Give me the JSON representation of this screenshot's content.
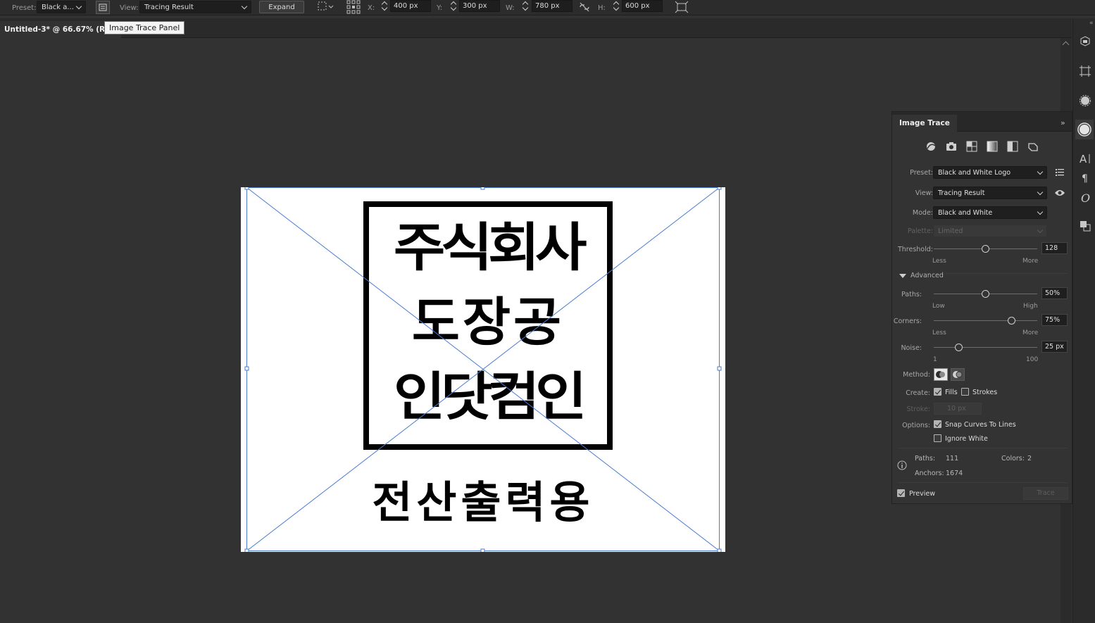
{
  "control_bar": {
    "preset_label": "Preset:",
    "preset_value": "Black a...",
    "view_label": "View:",
    "view_value": "Tracing Result",
    "expand_label": "Expand",
    "x_label": "X:",
    "x_value": "400 px",
    "y_label": "Y:",
    "y_value": "300 px",
    "w_label": "W:",
    "w_value": "780 px",
    "h_label": "H:",
    "h_value": "600 px"
  },
  "document": {
    "tab_title": "Untitled-3* @ 66.67% (RGB",
    "tooltip": "Image Trace Panel"
  },
  "artwork": {
    "seal_rows": [
      "주식회사",
      "도장공",
      "인닷컴인"
    ],
    "caption": "전산출력용"
  },
  "image_trace": {
    "title": "Image Trace",
    "collapse_glyph": "»",
    "preset_label": "Preset:",
    "preset_value": "Black and White Logo",
    "view_label": "View:",
    "view_value": "Tracing Result",
    "mode_label": "Mode:",
    "mode_value": "Black and White",
    "palette_label": "Palette:",
    "palette_value": "Limited",
    "threshold_label": "Threshold:",
    "threshold_value": "128",
    "threshold_min": "Less",
    "threshold_max": "More",
    "advanced_label": "Advanced",
    "paths_label": "Paths:",
    "paths_value": "50%",
    "paths_min": "Low",
    "paths_max": "High",
    "corners_label": "Corners:",
    "corners_value": "75%",
    "corners_min": "Less",
    "corners_max": "More",
    "noise_label": "Noise:",
    "noise_value": "25 px",
    "noise_min": "1",
    "noise_max": "100",
    "method_label": "Method:",
    "create_label": "Create:",
    "fills_label": "Fills",
    "strokes_label": "Strokes",
    "stroke_label": "Stroke:",
    "stroke_value": "10 px",
    "options_label": "Options:",
    "snap_label": "Snap Curves To Lines",
    "ignore_white_label": "Ignore White",
    "info_paths_label": "Paths:",
    "info_paths_value": "111",
    "info_colors_label": "Colors:",
    "info_colors_value": "2",
    "info_anchors_label": "Anchors:",
    "info_anchors_value": "1674",
    "preview_label": "Preview",
    "trace_button": "Trace",
    "threshold_level": 0.5,
    "paths_level": 0.5,
    "corners_level": 0.75,
    "noise_level": 0.24,
    "fills_checked": true,
    "strokes_checked": false,
    "snap_checked": true,
    "ignore_white_checked": false,
    "preview_checked": true
  },
  "colors": {
    "selection": "#4a7bd1",
    "panel_bg": "#333333",
    "canvas_bg": "#323232"
  }
}
